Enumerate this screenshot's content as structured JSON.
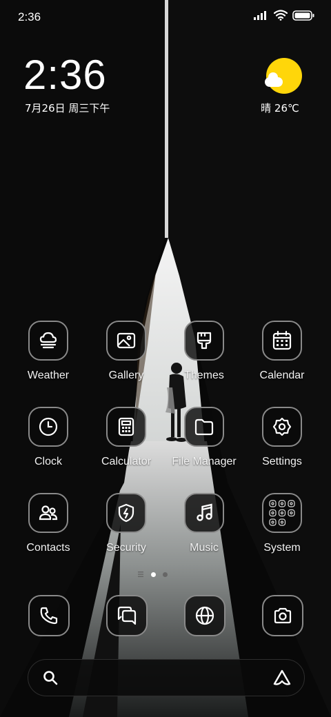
{
  "status_bar": {
    "time": "2:36",
    "icons": [
      "signal-icon",
      "wifi-icon",
      "battery-icon"
    ]
  },
  "clock_widget": {
    "time": "2:36",
    "date": "7月26日 周三下午"
  },
  "weather_widget": {
    "icon": "sun-cloud-icon",
    "text": "晴 26℃",
    "sun_color": "#FFD60A"
  },
  "apps": [
    {
      "label": "Weather",
      "icon": "weather-icon"
    },
    {
      "label": "Gallery",
      "icon": "gallery-icon"
    },
    {
      "label": "Themes",
      "icon": "themes-brush-icon"
    },
    {
      "label": "Calendar",
      "icon": "calendar-icon"
    },
    {
      "label": "Clock",
      "icon": "clock-icon"
    },
    {
      "label": "Calculator",
      "icon": "calculator-icon"
    },
    {
      "label": "File Manager",
      "icon": "folder-icon"
    },
    {
      "label": "Settings",
      "icon": "gear-icon"
    },
    {
      "label": "Contacts",
      "icon": "contacts-icon"
    },
    {
      "label": "Security",
      "icon": "shield-icon"
    },
    {
      "label": "Music",
      "icon": "music-note-icon"
    },
    {
      "label": "System",
      "icon": "folder-grid-icon"
    }
  ],
  "page_indicator": {
    "pages": 2,
    "current": 1
  },
  "dock": [
    {
      "icon": "phone-icon"
    },
    {
      "icon": "messages-icon"
    },
    {
      "icon": "browser-globe-icon"
    },
    {
      "icon": "camera-icon"
    }
  ],
  "search_bar": {
    "left_icon": "search-icon",
    "right_icon": "assistant-icon"
  }
}
